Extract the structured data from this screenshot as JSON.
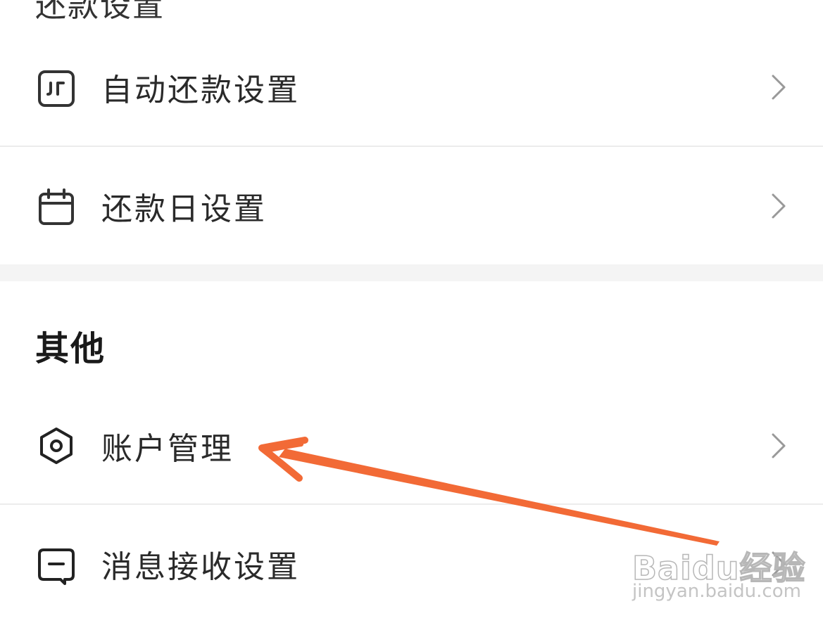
{
  "top_section": {
    "title": "还款设置"
  },
  "rows_top": [
    {
      "label": "自动还款设置",
      "icon": "auto-repay-icon"
    },
    {
      "label": "还款日设置",
      "icon": "calendar-icon"
    }
  ],
  "other_section": {
    "title": "其他"
  },
  "rows_other": [
    {
      "label": "账户管理",
      "icon": "hexagon-settings-icon"
    },
    {
      "label": "消息接收设置",
      "icon": "message-icon"
    }
  ],
  "annotation": {
    "color": "#f26a36",
    "points_to": "账户管理"
  },
  "watermark": {
    "logo": "Baidu经验",
    "url": "jingyan.baidu.com"
  },
  "colors": {
    "background": "#ffffff",
    "divider": "#ececec",
    "gap": "#f4f4f4",
    "chevron": "#999999",
    "icon": "#333333"
  }
}
